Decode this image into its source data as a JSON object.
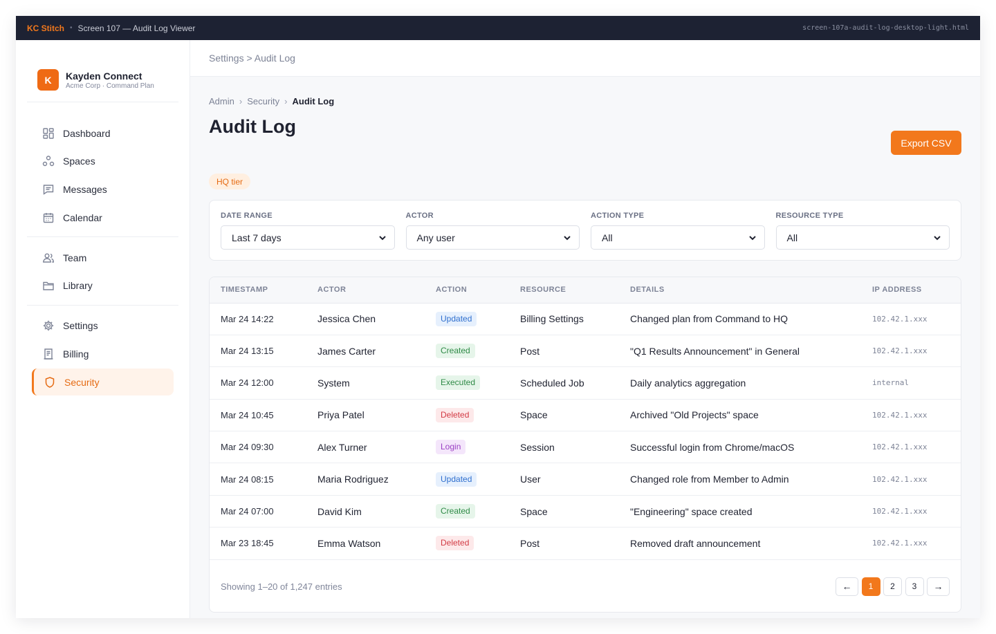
{
  "topbar": {
    "brand": "KC Stitch",
    "screen": "Screen 107 — Audit Log Viewer",
    "filename": "screen-107a-audit-log-desktop-light.html"
  },
  "org": {
    "initial": "K",
    "name": "Kayden Connect",
    "plan": "Acme Corp · Command Plan"
  },
  "nav": {
    "group1": [
      {
        "label": "Dashboard",
        "icon": "dashboard-icon"
      },
      {
        "label": "Spaces",
        "icon": "spaces-icon"
      },
      {
        "label": "Messages",
        "icon": "messages-icon"
      },
      {
        "label": "Calendar",
        "icon": "calendar-icon"
      }
    ],
    "group2": [
      {
        "label": "Team",
        "icon": "team-icon"
      },
      {
        "label": "Library",
        "icon": "folder-icon"
      }
    ],
    "group3": [
      {
        "label": "Settings",
        "icon": "gear-icon"
      },
      {
        "label": "Billing",
        "icon": "receipt-icon"
      },
      {
        "label": "Security",
        "icon": "shield-icon",
        "active": true
      }
    ]
  },
  "subheader": "Settings > Audit Log",
  "breadcrumb": [
    "Admin",
    "Security",
    "Audit Log"
  ],
  "title": "Audit Log",
  "export_label": "Export CSV",
  "tier_badge": "HQ tier",
  "filters": [
    {
      "label": "DATE RANGE",
      "value": "Last 7 days"
    },
    {
      "label": "ACTOR",
      "value": "Any user"
    },
    {
      "label": "ACTION TYPE",
      "value": "All"
    },
    {
      "label": "RESOURCE TYPE",
      "value": "All"
    }
  ],
  "table": {
    "columns": [
      "TIMESTAMP",
      "ACTOR",
      "ACTION",
      "RESOURCE",
      "DETAILS",
      "IP ADDRESS"
    ],
    "rows": [
      {
        "timestamp": "Mar 24 14:22",
        "actor": "Jessica Chen",
        "action": "Updated",
        "resource": "Billing Settings",
        "details": "Changed plan from Command to HQ",
        "ip": "102.42.1.xxx"
      },
      {
        "timestamp": "Mar 24 13:15",
        "actor": "James Carter",
        "action": "Created",
        "resource": "Post",
        "details": "\"Q1 Results Announcement\" in General",
        "ip": "102.42.1.xxx"
      },
      {
        "timestamp": "Mar 24 12:00",
        "actor": "System",
        "action": "Executed",
        "resource": "Scheduled Job",
        "details": "Daily analytics aggregation",
        "ip": "internal"
      },
      {
        "timestamp": "Mar 24 10:45",
        "actor": "Priya Patel",
        "action": "Deleted",
        "resource": "Space",
        "details": "Archived \"Old Projects\" space",
        "ip": "102.42.1.xxx"
      },
      {
        "timestamp": "Mar 24 09:30",
        "actor": "Alex Turner",
        "action": "Login",
        "resource": "Session",
        "details": "Successful login from Chrome/macOS",
        "ip": "102.42.1.xxx"
      },
      {
        "timestamp": "Mar 24 08:15",
        "actor": "Maria Rodriguez",
        "action": "Updated",
        "resource": "User",
        "details": "Changed role from Member to Admin",
        "ip": "102.42.1.xxx"
      },
      {
        "timestamp": "Mar 24 07:00",
        "actor": "David Kim",
        "action": "Created",
        "resource": "Space",
        "details": "\"Engineering\" space created",
        "ip": "102.42.1.xxx"
      },
      {
        "timestamp": "Mar 23 18:45",
        "actor": "Emma Watson",
        "action": "Deleted",
        "resource": "Post",
        "details": "Removed draft announcement",
        "ip": "102.42.1.xxx"
      }
    ]
  },
  "footer": {
    "showing": "Showing 1–20 of 1,247 entries",
    "prev": "←",
    "pages": [
      "1",
      "2",
      "3"
    ],
    "current_page": "1",
    "next": "→"
  },
  "colors": {
    "accent": "#f2781c",
    "topbar": "#1d2233",
    "badge_updated": "#2f6fce",
    "badge_created": "#2e8a46",
    "badge_deleted": "#d23a44",
    "badge_login": "#9b3fc4"
  }
}
